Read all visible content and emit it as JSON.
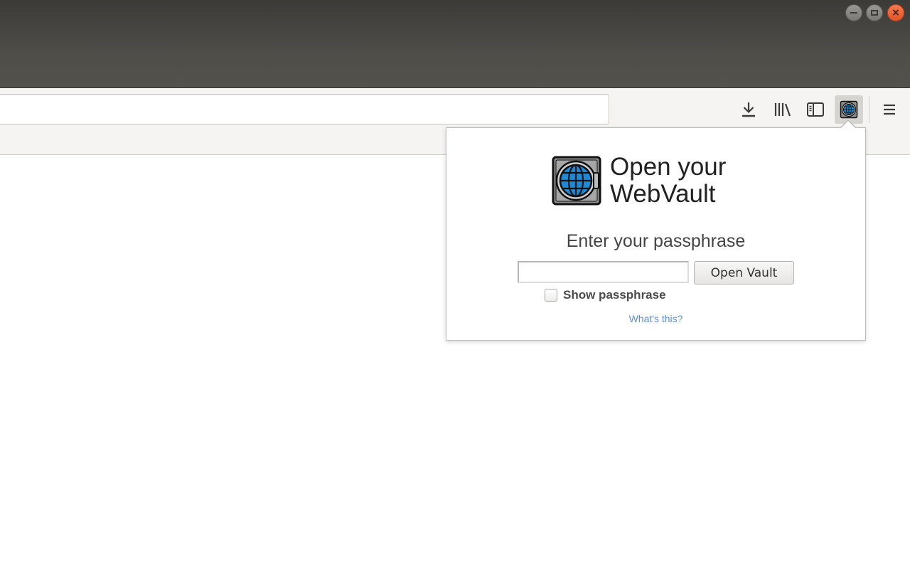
{
  "window": {
    "controls": [
      "minimize",
      "maximize",
      "close"
    ],
    "close_glyph": "×"
  },
  "toolbar": {
    "url_value": "",
    "buttons": [
      {
        "icon": "download-arrow-icon"
      },
      {
        "icon": "library-icon"
      },
      {
        "icon": "sidebar-icon"
      },
      {
        "icon": "webvault-globe-icon",
        "active": true
      },
      {
        "icon": "hamburger-menu-icon"
      }
    ]
  },
  "popup": {
    "heading": "Open your WebVault",
    "subheading": "Enter your passphrase",
    "passphrase_value": "",
    "open_button": "Open Vault",
    "show_passphrase_label": "Show passphrase",
    "show_passphrase_checked": false,
    "help_link": "What's this?"
  },
  "colors": {
    "titlebar": "#3c3b37",
    "toolbar": "#f5f4f2",
    "close_button": "#e95420",
    "link": "#5a8fd6",
    "globe": "#1e8ad6"
  }
}
